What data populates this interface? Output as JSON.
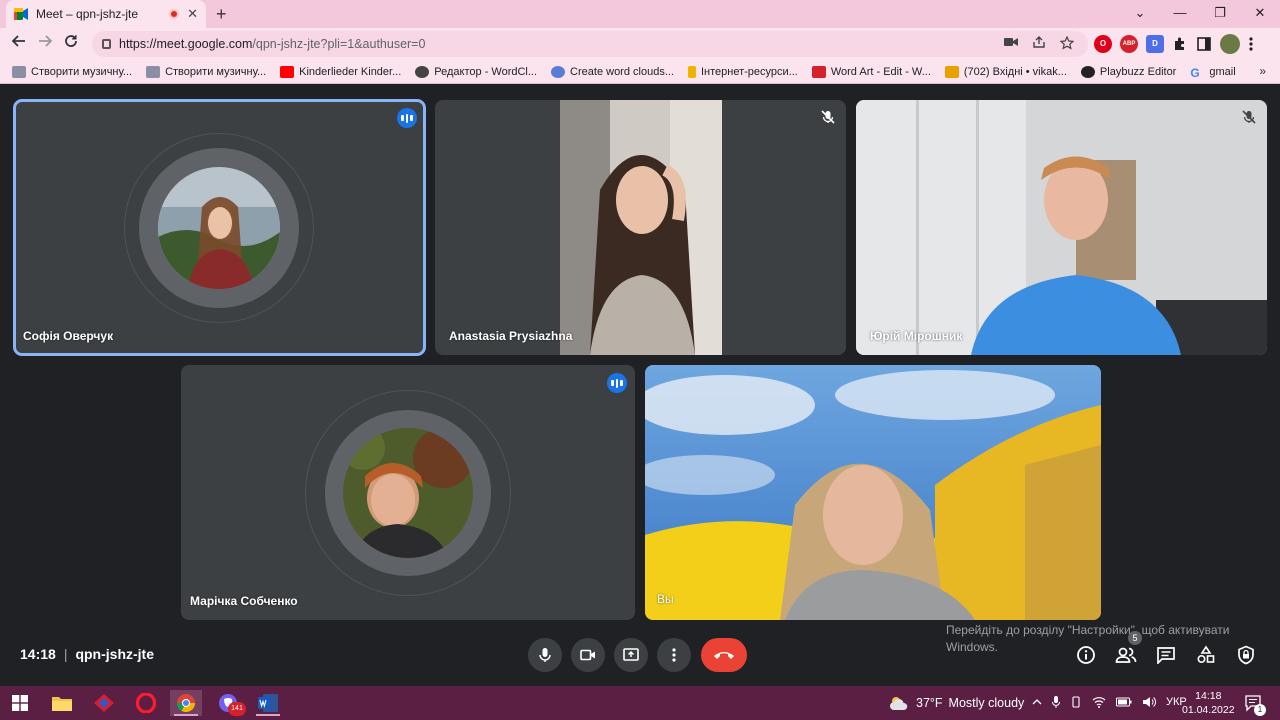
{
  "browser": {
    "tab_title": "Meet – qpn-jshz-jte",
    "tab_close": "✕",
    "new_tab": "+",
    "window_buttons": [
      "⌄",
      "—",
      "❐",
      "✕"
    ],
    "url_host": "https://meet.google.com",
    "url_path": "/qpn-jshz-jte?pli=1&authuser=0",
    "extensions": [
      {
        "name": "opera-icon",
        "label": "O",
        "color": "#e1001a"
      },
      {
        "name": "adblock-icon",
        "label": "ABP",
        "color": "#d6202b"
      },
      {
        "name": "d-extension-icon",
        "label": "D",
        "color": "#4f6ee8"
      }
    ],
    "bookmarks": [
      {
        "label": "Створити музичну...",
        "color": "#8a8fa3"
      },
      {
        "label": "Створити музичну...",
        "color": "#8a8fa3"
      },
      {
        "label": "Kinderlieder Kinder...",
        "color": "#ff0000"
      },
      {
        "label": "Редактор - WordCl...",
        "color": "#444444"
      },
      {
        "label": "Create word clouds...",
        "color": "#5b7bd5"
      },
      {
        "label": "Інтернет-ресурси...",
        "color": "#f0b400"
      },
      {
        "label": "Word Art - Edit - W...",
        "color": "#d6202b"
      },
      {
        "label": "(702) Вхідні • vikak...",
        "color": "#e9a100"
      },
      {
        "label": "Playbuzz Editor",
        "color": "#222222"
      },
      {
        "label": "gmail",
        "color": "#4285f4"
      }
    ],
    "bookmarks_more": "»"
  },
  "tiles": [
    {
      "name": "Софія Оверчук",
      "state": "speaking",
      "active": true
    },
    {
      "name": "Anastasia Prysiazhna",
      "state": "muted"
    },
    {
      "name": "Юрій Мірошник",
      "state": "muted"
    },
    {
      "name": "Марічка Собченко",
      "state": "speaking"
    },
    {
      "name": "Вы",
      "state": "self"
    }
  ],
  "meeting": {
    "time": "14:18",
    "separator": "|",
    "code": "qpn-jshz-jte",
    "participants_count": "5"
  },
  "windows_watermark": {
    "line1": "Перейдіть до розділу \"Настройки\", щоб активувати",
    "line2": "Windows."
  },
  "taskbar": {
    "weather_temp": "37°F",
    "weather_text": "Mostly cloudy",
    "lang": "УКР",
    "time": "14:18",
    "date": "01.04.2022",
    "viber_badge": "141",
    "notif_count": "1"
  },
  "colors": {
    "accent_blue": "#1a73e8",
    "end_call": "#ea4335",
    "tile_bg": "#3c4043",
    "page_bg": "#202124"
  }
}
